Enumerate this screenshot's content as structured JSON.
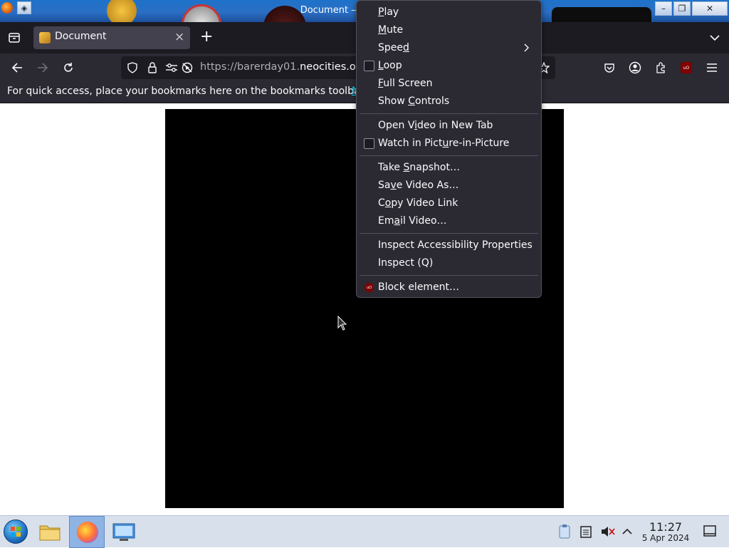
{
  "window": {
    "title": "Document — Mozilla Firefox",
    "buttons": [
      "–",
      "❐",
      "✕"
    ]
  },
  "tab": {
    "title": "Document",
    "close": "×",
    "new": "+"
  },
  "navbar": {
    "url_prefix": "https://barerday01.",
    "url_domain": "neocities.org"
  },
  "bookmarks_bar": {
    "text": "For quick access, place your bookmarks here on the bookmarks toolbar.",
    "link": "M"
  },
  "context_menu": {
    "groups": [
      [
        {
          "label": "Play",
          "ak": "P"
        },
        {
          "label": "Mute",
          "ak": "M"
        },
        {
          "label": "Speed",
          "ak": "d",
          "submenu": true
        },
        {
          "label": "Loop",
          "ak": "L",
          "checkbox": true
        },
        {
          "label": "Full Screen",
          "ak": "F"
        },
        {
          "label": "Show Controls",
          "ak": "C"
        }
      ],
      [
        {
          "label": "Open Video in New Tab",
          "ak": "i"
        },
        {
          "label": "Watch in Picture-in-Picture",
          "ak": "u",
          "checkbox": true
        }
      ],
      [
        {
          "label": "Take Snapshot…",
          "ak": "S"
        },
        {
          "label": "Save Video As…",
          "ak": "v"
        },
        {
          "label": "Copy Video Link",
          "ak": "o"
        },
        {
          "label": "Email Video…",
          "ak": "a"
        }
      ],
      [
        {
          "label": "Inspect Accessibility Properties",
          "ak": ""
        },
        {
          "label": "Inspect (Q)",
          "ak": ""
        }
      ],
      [
        {
          "label": "Block element…",
          "ak": "",
          "icon": "ublock-icon"
        }
      ]
    ]
  },
  "taskbar": {
    "time": "11:27",
    "date": "5 Apr 2024"
  },
  "colors": {
    "menu_bg": "#2b2a33",
    "toolbar_bg": "#2b2a33",
    "tabstrip_bg": "#1c1b22",
    "accent_link": "#00ddff",
    "ublock": "#800000"
  }
}
